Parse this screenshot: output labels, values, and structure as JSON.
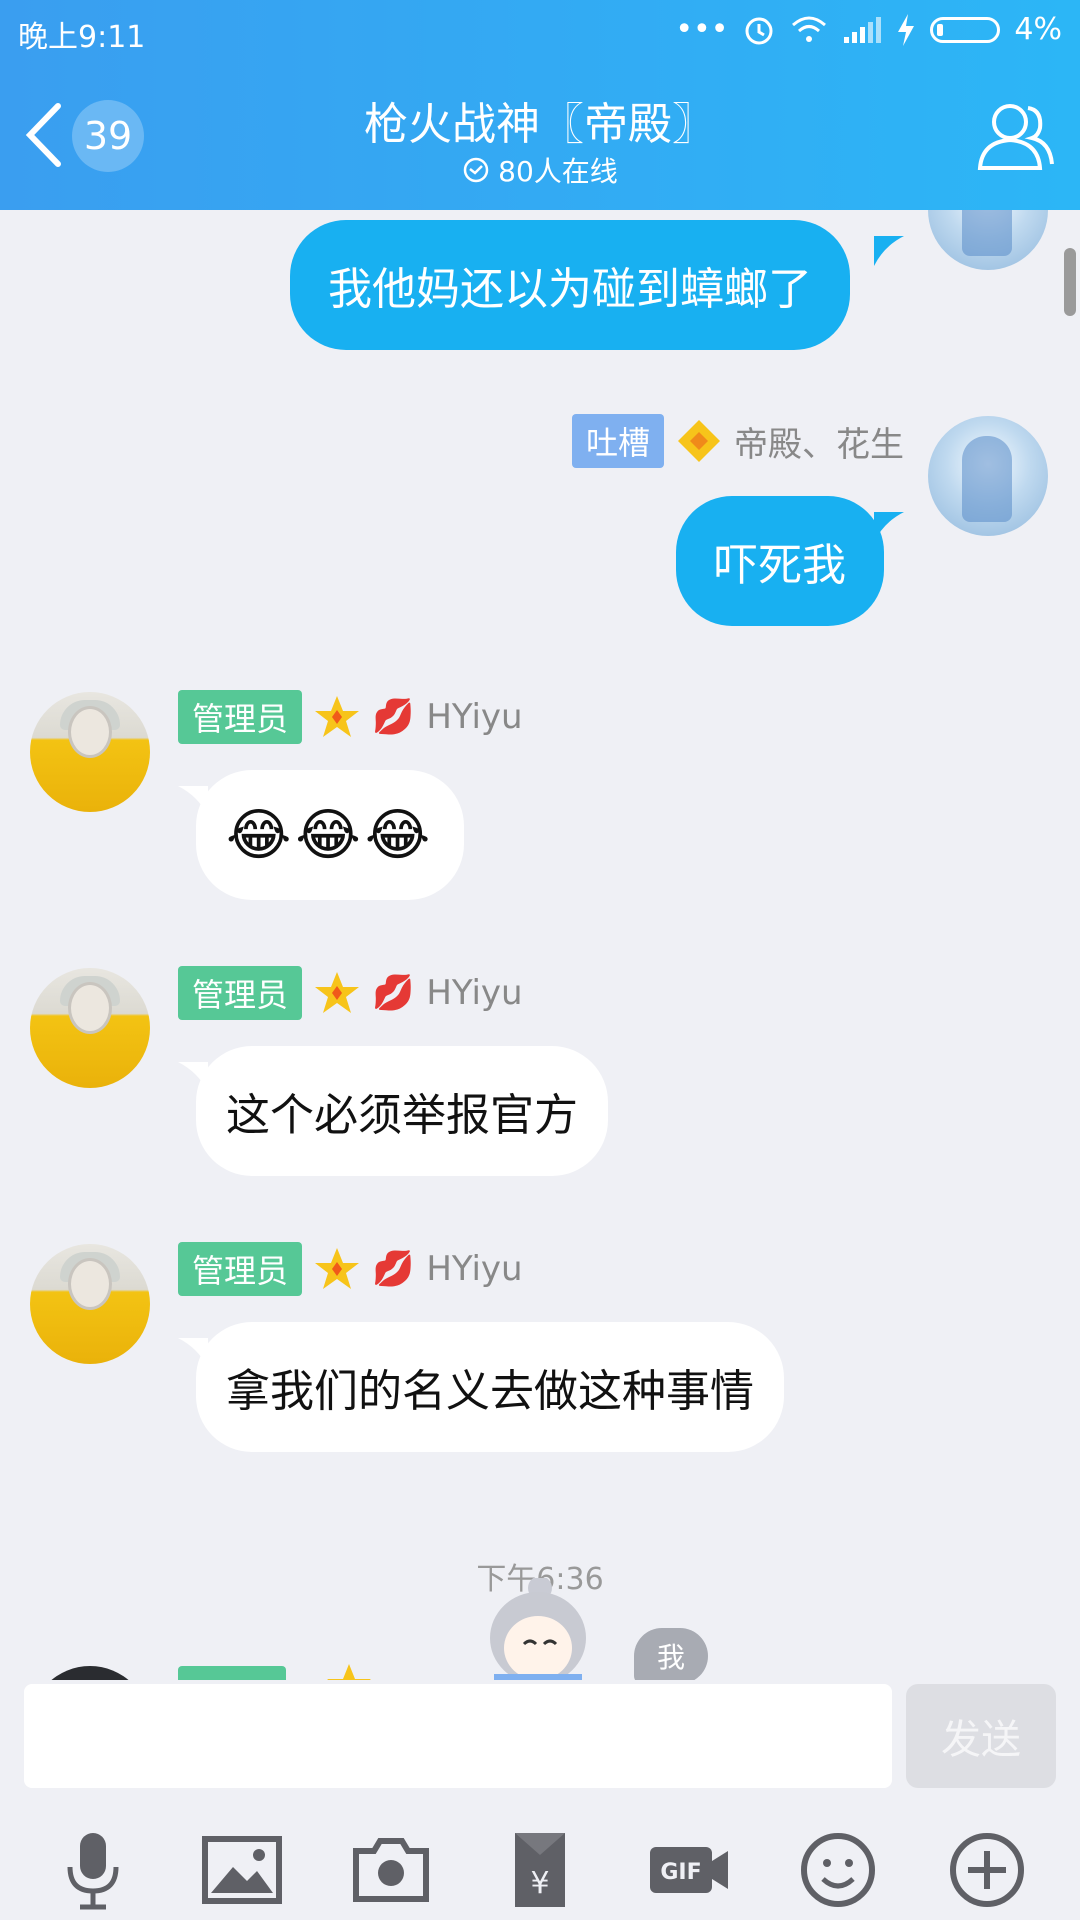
{
  "status_bar": {
    "time": "晚上9:11",
    "battery": "4%"
  },
  "header": {
    "unread_count": "39",
    "title": "枪火战神〖帝殿〗",
    "online": "80人在线"
  },
  "messages": [
    {
      "direction": "out",
      "text": "我他妈还以为碰到蟑螂了"
    },
    {
      "direction": "out",
      "tag": "吐槽",
      "sender": "帝殿、花生",
      "text": "吓死我"
    },
    {
      "direction": "in",
      "tag": "管理员",
      "sender": "HYiyu",
      "text": "😂😂😂"
    },
    {
      "direction": "in",
      "tag": "管理员",
      "sender": "HYiyu",
      "text": "这个必须举报官方"
    },
    {
      "direction": "in",
      "tag": "管理员",
      "sender": "HYiyu",
      "text": "拿我们的名义去做这种事情"
    }
  ],
  "timestamp": "下午6:36",
  "me_chip": "我",
  "input": {
    "value": "",
    "send_label": "发送"
  },
  "toolbar_icons": [
    "microphone-icon",
    "image-icon",
    "camera-icon",
    "red-packet-icon",
    "gif-icon",
    "emoji-icon",
    "plus-icon"
  ],
  "colors": {
    "header_gradient_start": "#3a9ef0",
    "header_gradient_end": "#2cb6f6",
    "outgoing_bubble": "#18b0f1",
    "admin_tag": "#56c896",
    "rant_tag": "#7fb0f0"
  }
}
